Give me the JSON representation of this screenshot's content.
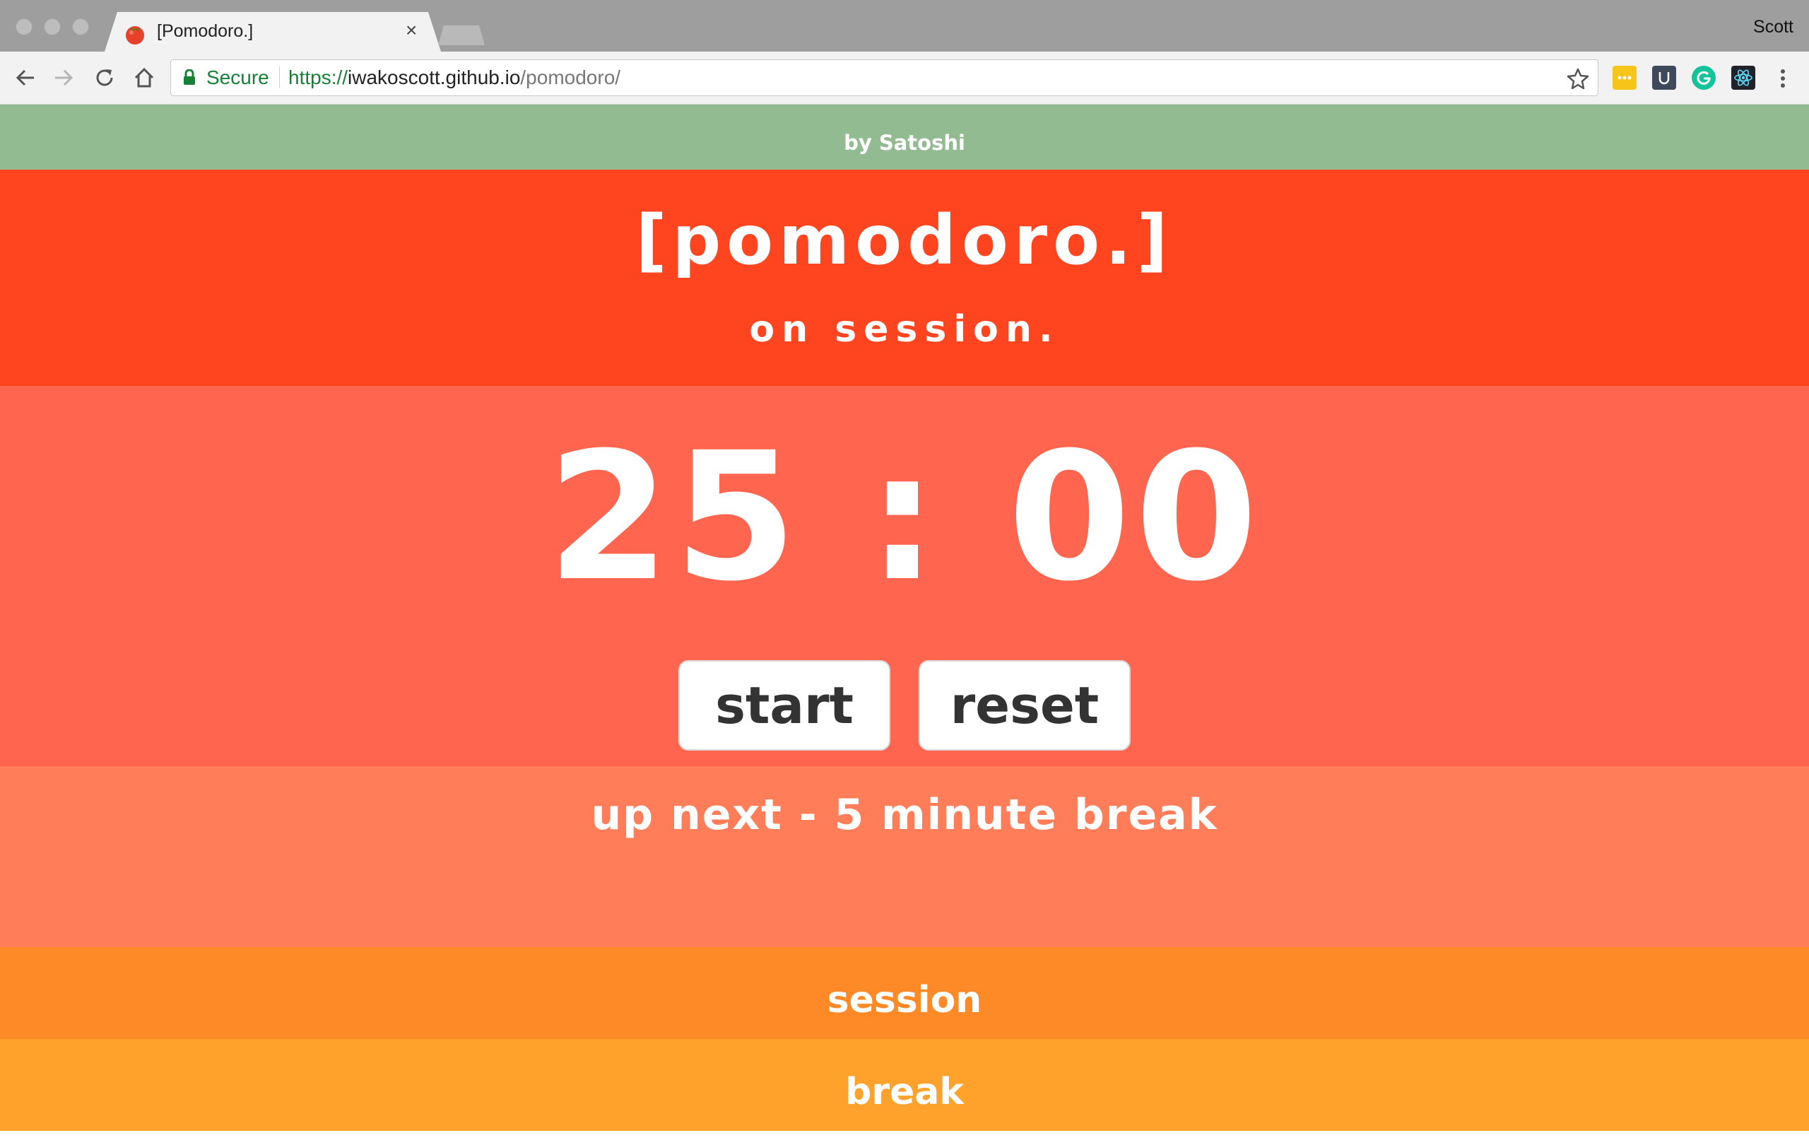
{
  "browser": {
    "tab_title": "[Pomodoro.]",
    "profile_name": "Scott",
    "secure_label": "Secure",
    "url": {
      "scheme": "https://",
      "host": "iwakoscott.github.io",
      "path": "/pomodoro/"
    },
    "icons": [
      "back-icon",
      "forward-icon",
      "reload-icon",
      "home-icon",
      "lock-icon",
      "star-icon",
      "menu-icon"
    ],
    "extensions": [
      "notes-extension-icon",
      "u-extension-icon",
      "grammarly-extension-icon",
      "react-devtools-icon"
    ]
  },
  "page": {
    "byline": "by Satoshi",
    "title": "[pomodoro.]",
    "status": "on session.",
    "timer": {
      "minutes": "25",
      "separator": ":",
      "seconds": "00"
    },
    "buttons": {
      "start": "start",
      "reset": "reset"
    },
    "up_next": "up next - 5 minute break",
    "session_label": "session",
    "break_label": "break",
    "colors": {
      "byline_bar": "#93bb92",
      "header": "#ff4520",
      "timer_section": "#ff654f",
      "up_next_section": "#ff7e59",
      "session_bar": "#fd8a26",
      "break_bar": "#ffa22b"
    }
  }
}
